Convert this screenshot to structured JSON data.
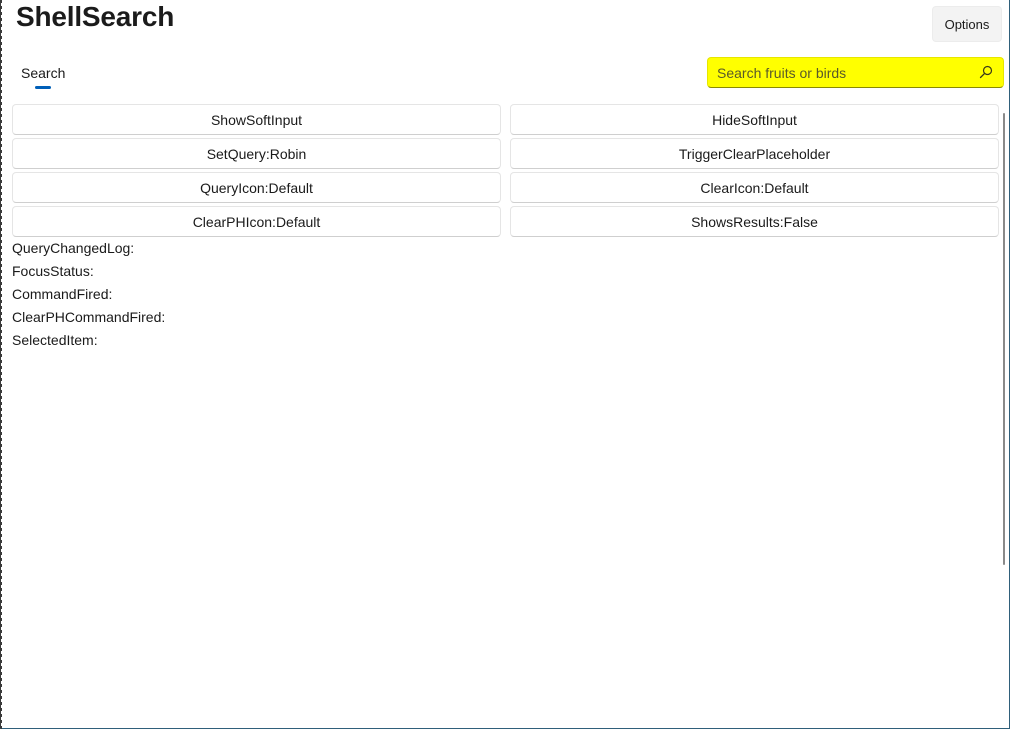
{
  "app": {
    "title": "ShellSearch"
  },
  "toolbar": {
    "options_label": "Options"
  },
  "tabs": [
    {
      "label": "Search",
      "selected": true
    }
  ],
  "search": {
    "placeholder": "Search fruits or birds",
    "value": "",
    "background_color": "#ffff00",
    "icon": "search-icon"
  },
  "buttons": {
    "show_soft_input": "ShowSoftInput",
    "hide_soft_input": "HideSoftInput",
    "set_query": "SetQuery:Robin",
    "trigger_clear_placeholder": "TriggerClearPlaceholder",
    "query_icon": "QueryIcon:Default",
    "clear_icon": "ClearIcon:Default",
    "clear_ph_icon": "ClearPHIcon:Default",
    "shows_results": "ShowsResults:False"
  },
  "log": {
    "query_changed": "QueryChangedLog:",
    "focus_status": "FocusStatus:",
    "command_fired": "CommandFired:",
    "clear_ph_command_fired": "ClearPHCommandFired:",
    "selected_item": "SelectedItem:"
  },
  "colors": {
    "accent": "#005fb8"
  }
}
